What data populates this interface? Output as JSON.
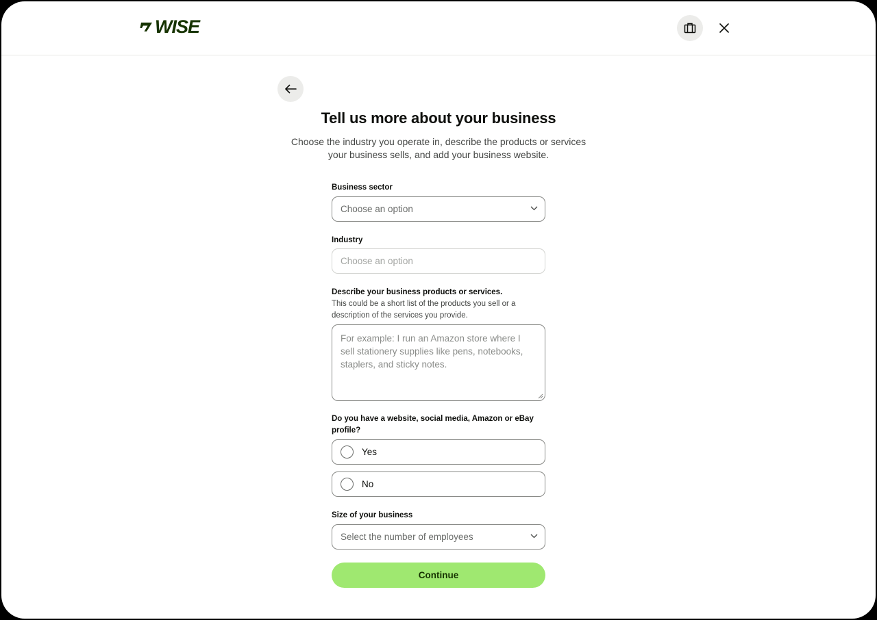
{
  "header": {
    "logo_text": "WISE",
    "briefcase_icon": "briefcase-icon",
    "close_icon": "close-icon"
  },
  "back_icon": "arrow-left-icon",
  "title": "Tell us more about your business",
  "subtitle": "Choose the industry you operate in, describe the products or services your business sells, and add your business website.",
  "form": {
    "business_sector": {
      "label": "Business sector",
      "placeholder": "Choose an option"
    },
    "industry": {
      "label": "Industry",
      "placeholder": "Choose an option"
    },
    "description": {
      "label": "Describe your business products or services.",
      "help": "This could be a short list of the products you sell or a description of the services you provide.",
      "placeholder": "For example: I run an Amazon store where I sell stationery supplies like pens, notebooks, staplers, and sticky notes."
    },
    "website_question": {
      "label": "Do you have a website, social media, Amazon or eBay profile?",
      "options": [
        "Yes",
        "No"
      ]
    },
    "size": {
      "label": "Size of your business",
      "placeholder": "Select the number of employees"
    },
    "continue_label": "Continue"
  },
  "colors": {
    "brand_green": "#9fe870",
    "brand_dark": "#163300"
  }
}
